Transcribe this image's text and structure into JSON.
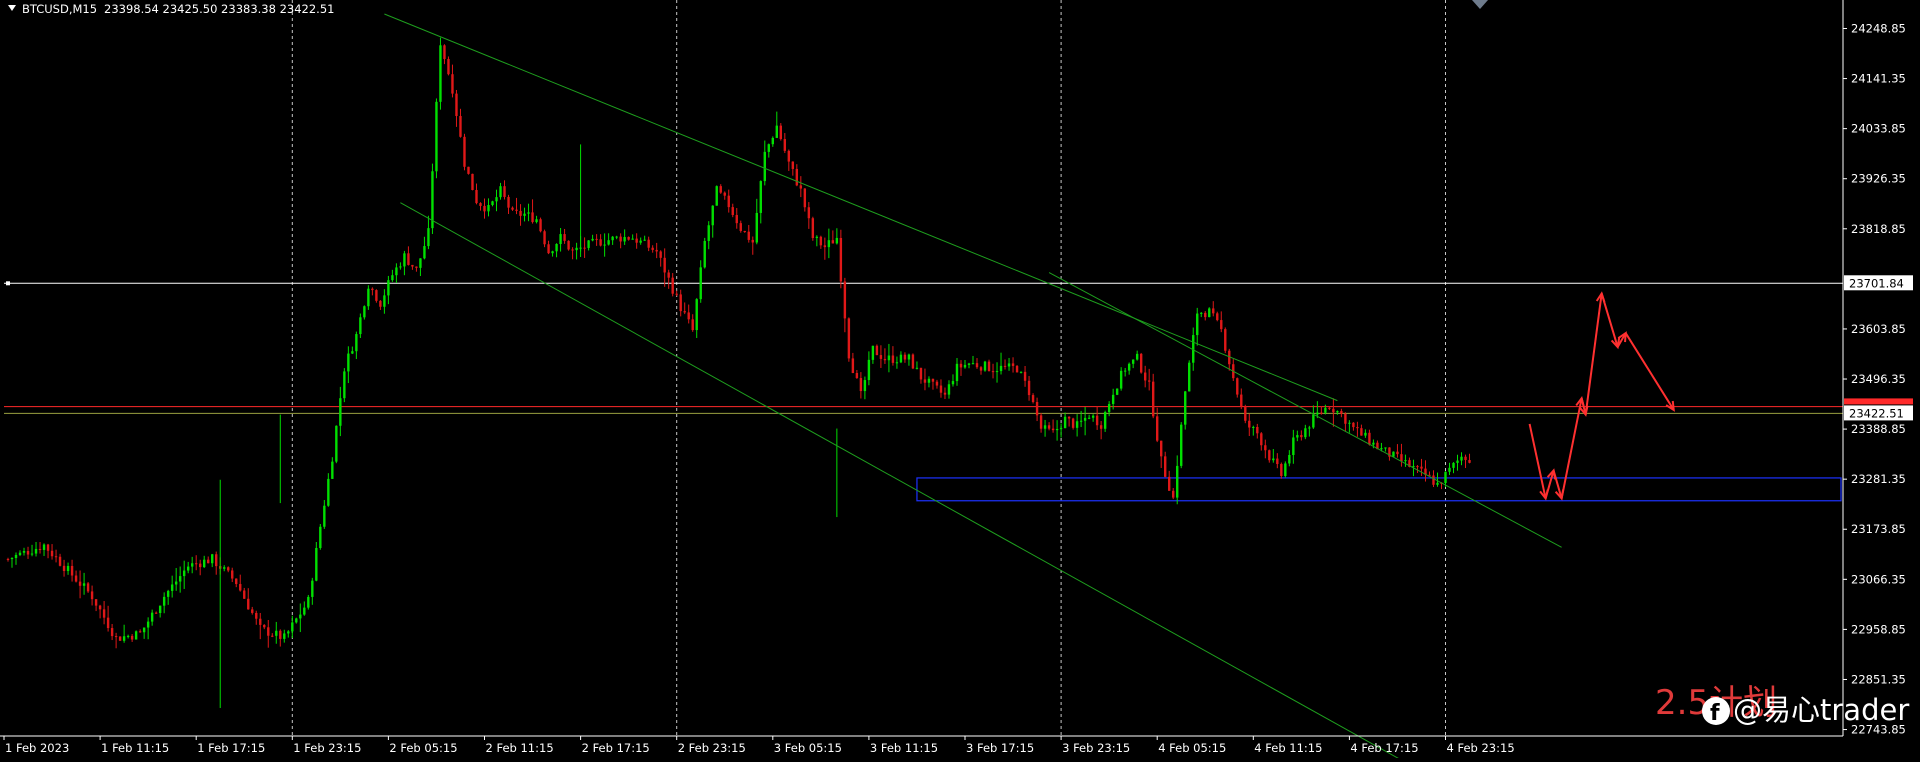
{
  "header": {
    "symbol": "BTCUSD,M15",
    "ohlc": "23398.54 23425.50 23383.38 23422.51"
  },
  "colors": {
    "background": "#000000",
    "bull": "#00e000",
    "bear": "#e01818",
    "grid": "#c8c8c8",
    "channel": "#1e9e1e",
    "resistance_line": "#ffffff",
    "price_line": "#ff2a2a",
    "support_box": "#1c32ff",
    "projection": "#ff3030",
    "axis": "#ffffff"
  },
  "watermark": {
    "plan": "2.5计划",
    "brand": "@易心trader",
    "icon": "facebook-icon"
  },
  "chart_data": {
    "type": "candlestick",
    "symbol": "BTCUSD",
    "timeframe": "M15",
    "y_ticks": [
      "24248.85",
      "24141.35",
      "24033.85",
      "23926.35",
      "23818.85",
      "23603.85",
      "23496.35",
      "23388.85",
      "23281.35",
      "23173.85",
      "23066.35",
      "22958.85",
      "22851.35",
      "22743.85"
    ],
    "ylim": [
      22730,
      24310
    ],
    "x_ticks": [
      "1 Feb 2023",
      "1 Feb 11:15",
      "1 Feb 17:15",
      "1 Feb 23:15",
      "2 Feb 05:15",
      "2 Feb 11:15",
      "2 Feb 17:15",
      "2 Feb 23:15",
      "3 Feb 05:15",
      "3 Feb 11:15",
      "3 Feb 17:15",
      "3 Feb 23:15",
      "4 Feb 05:15",
      "4 Feb 11:15",
      "4 Feb 17:15",
      "4 Feb 23:15"
    ],
    "price_labels": {
      "resistance": "23701.84",
      "current": "23422.51"
    },
    "resistance_level": 23701.84,
    "current_price": 23422.51,
    "red_line_upper": 23437,
    "support_zone": [
      23235,
      23284
    ],
    "close_path": [
      [
        0,
        23110
      ],
      [
        3,
        23140
      ],
      [
        5,
        23085
      ],
      [
        7,
        23030
      ],
      [
        9,
        22940
      ],
      [
        11,
        22950
      ],
      [
        13,
        23030
      ],
      [
        15,
        23095
      ],
      [
        17,
        23110
      ],
      [
        19,
        23060
      ],
      [
        21,
        22960
      ],
      [
        23,
        22940
      ],
      [
        25,
        23020
      ],
      [
        26,
        23180
      ],
      [
        27,
        23330
      ],
      [
        28,
        23520
      ],
      [
        29,
        23590
      ],
      [
        30,
        23700
      ],
      [
        31,
        23660
      ],
      [
        32,
        23720
      ],
      [
        33,
        23760
      ],
      [
        34,
        23730
      ],
      [
        35,
        23810
      ],
      [
        36,
        24220
      ],
      [
        37,
        24120
      ],
      [
        38,
        23960
      ],
      [
        39,
        23880
      ],
      [
        40,
        23860
      ],
      [
        41,
        23900
      ],
      [
        42,
        23850
      ],
      [
        43,
        23850
      ],
      [
        44,
        23840
      ],
      [
        45,
        23770
      ],
      [
        46,
        23800
      ],
      [
        47,
        23770
      ],
      [
        49,
        23790
      ],
      [
        51,
        23800
      ],
      [
        52,
        23800
      ],
      [
        54,
        23770
      ],
      [
        56,
        23650
      ],
      [
        57,
        23600
      ],
      [
        58,
        23790
      ],
      [
        59,
        23900
      ],
      [
        60,
        23870
      ],
      [
        61,
        23820
      ],
      [
        62,
        23790
      ],
      [
        63,
        23980
      ],
      [
        64,
        24040
      ],
      [
        65,
        23960
      ],
      [
        66,
        23900
      ],
      [
        67,
        23800
      ],
      [
        68,
        23780
      ],
      [
        69,
        23800
      ],
      [
        70,
        23550
      ],
      [
        71,
        23460
      ],
      [
        72,
        23560
      ],
      [
        73,
        23540
      ],
      [
        74,
        23540
      ],
      [
        75,
        23540
      ],
      [
        76,
        23500
      ],
      [
        78,
        23460
      ],
      [
        79,
        23520
      ],
      [
        80,
        23530
      ],
      [
        82,
        23520
      ],
      [
        84,
        23520
      ],
      [
        85,
        23470
      ],
      [
        86,
        23390
      ],
      [
        87,
        23380
      ],
      [
        88,
        23410
      ],
      [
        89,
        23395
      ],
      [
        90,
        23420
      ],
      [
        91,
        23400
      ],
      [
        92,
        23470
      ],
      [
        93,
        23520
      ],
      [
        94,
        23540
      ],
      [
        95,
        23480
      ],
      [
        96,
        23320
      ],
      [
        97,
        23240
      ],
      [
        98,
        23470
      ],
      [
        99,
        23640
      ],
      [
        100,
        23640
      ],
      [
        101,
        23600
      ],
      [
        102,
        23500
      ],
      [
        103,
        23400
      ],
      [
        104,
        23380
      ],
      [
        105,
        23330
      ],
      [
        106,
        23290
      ],
      [
        107,
        23360
      ],
      [
        108,
        23390
      ],
      [
        109,
        23420
      ],
      [
        110,
        23440
      ],
      [
        111,
        23420
      ],
      [
        112,
        23390
      ],
      [
        113,
        23370
      ],
      [
        114,
        23350
      ],
      [
        116,
        23320
      ],
      [
        118,
        23290
      ],
      [
        119,
        23270
      ],
      [
        120,
        23300
      ],
      [
        121,
        23330
      ],
      [
        123,
        23320
      ],
      [
        124,
        23300
      ],
      [
        125,
        23320
      ],
      [
        127,
        23340
      ],
      [
        129,
        23350
      ],
      [
        130,
        23350
      ],
      [
        131,
        23390
      ],
      [
        132,
        23510
      ],
      [
        133,
        23480
      ],
      [
        134,
        23430
      ],
      [
        135,
        23410
      ],
      [
        136,
        23400
      ],
      [
        137,
        23400
      ],
      [
        138,
        23420
      ],
      [
        139,
        23420
      ],
      [
        141,
        23410
      ],
      [
        143,
        23400
      ],
      [
        144,
        23410
      ],
      [
        145,
        23400
      ],
      [
        146,
        23390
      ],
      [
        147,
        23420
      ]
    ],
    "channel_lines": [
      {
        "from": [
          "1 Feb 23:45",
          24280
        ],
        "to": [
          "4 Feb 11:15",
          23450
        ]
      },
      {
        "from": [
          "2 Feb 00:45",
          23875
        ],
        "to": [
          "4 Feb 17:15",
          22640
        ]
      },
      {
        "from": [
          "3 Feb 17:15",
          23725
        ],
        "to": [
          "5 Feb 01:15",
          23135
        ]
      }
    ],
    "projection_path": [
      [
        "4 Feb 23:15",
        23400
      ],
      [
        "5 Feb 00:15",
        23240
      ],
      [
        "5 Feb 00:45",
        23300
      ],
      [
        "5 Feb 01:15",
        23240
      ],
      [
        "5 Feb 02:30",
        23455
      ],
      [
        "5 Feb 02:45",
        23420
      ],
      [
        "5 Feb 03:45",
        23680
      ],
      [
        "5 Feb 04:45",
        23565
      ],
      [
        "5 Feb 05:15",
        23595
      ],
      [
        "5 Feb 08:15",
        23430
      ]
    ]
  }
}
